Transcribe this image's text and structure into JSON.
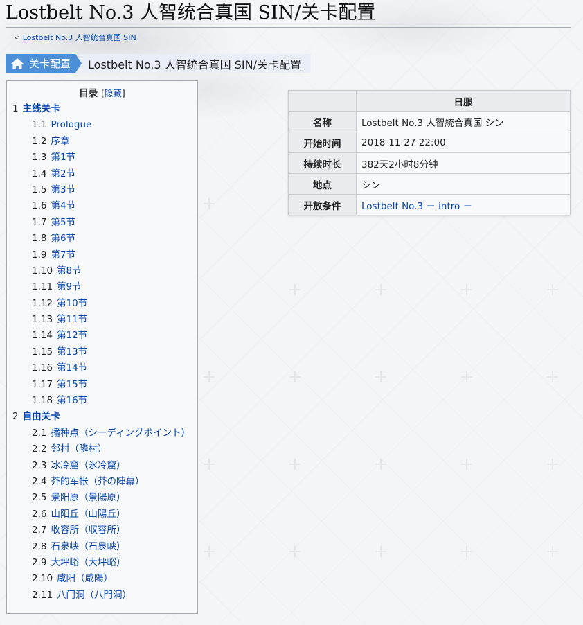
{
  "page": {
    "title": "Lostbelt No.3 人智统合真国 SIN/关卡配置",
    "subpage_prefix": "< ",
    "subpage_link": "Lostbelt No.3 人智统合真国 SIN"
  },
  "breadcrumb": {
    "home_label": "关卡配置",
    "current": "Lostbelt No.3 人智统合真国 SIN/关卡配置"
  },
  "toc": {
    "title": "目录",
    "toggle_open": "[",
    "toggle_label": "隐藏",
    "toggle_close": "]",
    "items": [
      {
        "level": 1,
        "num": "1",
        "label": "主线关卡"
      },
      {
        "level": 2,
        "num": "1.1",
        "label": "Prologue"
      },
      {
        "level": 2,
        "num": "1.2",
        "label": "序章"
      },
      {
        "level": 2,
        "num": "1.3",
        "label": "第1节"
      },
      {
        "level": 2,
        "num": "1.4",
        "label": "第2节"
      },
      {
        "level": 2,
        "num": "1.5",
        "label": "第3节"
      },
      {
        "level": 2,
        "num": "1.6",
        "label": "第4节"
      },
      {
        "level": 2,
        "num": "1.7",
        "label": "第5节"
      },
      {
        "level": 2,
        "num": "1.8",
        "label": "第6节"
      },
      {
        "level": 2,
        "num": "1.9",
        "label": "第7节"
      },
      {
        "level": 2,
        "num": "1.10",
        "label": "第8节"
      },
      {
        "level": 2,
        "num": "1.11",
        "label": "第9节"
      },
      {
        "level": 2,
        "num": "1.12",
        "label": "第10节"
      },
      {
        "level": 2,
        "num": "1.13",
        "label": "第11节"
      },
      {
        "level": 2,
        "num": "1.14",
        "label": "第12节"
      },
      {
        "level": 2,
        "num": "1.15",
        "label": "第13节"
      },
      {
        "level": 2,
        "num": "1.16",
        "label": "第14节"
      },
      {
        "level": 2,
        "num": "1.17",
        "label": "第15节"
      },
      {
        "level": 2,
        "num": "1.18",
        "label": "第16节"
      },
      {
        "level": 1,
        "num": "2",
        "label": "自由关卡"
      },
      {
        "level": 2,
        "num": "2.1",
        "label": "播种点（シーディングポイント）"
      },
      {
        "level": 2,
        "num": "2.2",
        "label": "邻村（隣村）"
      },
      {
        "level": 2,
        "num": "2.3",
        "label": "冰冷窟（氷冷窟）"
      },
      {
        "level": 2,
        "num": "2.4",
        "label": "芥的军帐（芥の陣幕）"
      },
      {
        "level": 2,
        "num": "2.5",
        "label": "景阳原（景陽原）"
      },
      {
        "level": 2,
        "num": "2.6",
        "label": "山阳丘（山陽丘）"
      },
      {
        "level": 2,
        "num": "2.7",
        "label": "收容所（収容所）"
      },
      {
        "level": 2,
        "num": "2.8",
        "label": "石泉峡（石泉峡）"
      },
      {
        "level": 2,
        "num": "2.9",
        "label": "大坪峪（大坪峪）"
      },
      {
        "level": 2,
        "num": "2.10",
        "label": "咸阳（咸陽）"
      },
      {
        "level": 2,
        "num": "2.11",
        "label": "八门洞（八門洞）"
      }
    ]
  },
  "infobox": {
    "header": "日服",
    "rows": [
      {
        "label": "名称",
        "value": "Lostbelt No.3 人智統合真国 シン",
        "link": false
      },
      {
        "label": "开始时间",
        "value": "2018-11-27 22:00",
        "link": false
      },
      {
        "label": "持续时长",
        "value": "382天2小时8分钟",
        "link": false
      },
      {
        "label": "地点",
        "value": "シン",
        "link": false
      },
      {
        "label": "开放条件",
        "value": "Lostbelt No.3 － intro －",
        "link": true
      }
    ]
  },
  "icons": {
    "home": "home-icon"
  },
  "colors": {
    "link": "#0645ad",
    "breadcrumb_home": "#4d8fd6",
    "breadcrumb_current": "#e9eef7"
  }
}
